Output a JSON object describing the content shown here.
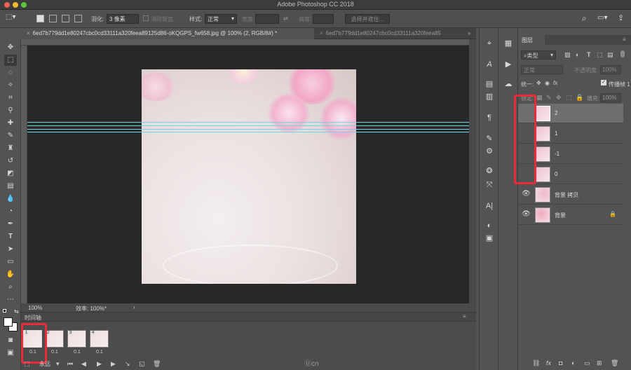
{
  "app": {
    "title": "Adobe Photoshop CC 2018"
  },
  "options_bar": {
    "feather_label": "羽化:",
    "feather_value": "3 像素",
    "antialias_label": "消除锯齿",
    "style_label": "样式:",
    "style_value": "正常",
    "width_label": "宽度:",
    "height_label": "高度:",
    "select_mask_button": "选择并遮住..."
  },
  "tabs": [
    {
      "label": "6ed7b779dd1e80247cbc0cd33111a320feea89125d86-oKQGPS_fw658.jpg @ 100% (2, RGB/8#) *"
    },
    {
      "label": "6ed7b779dd1e80247cbc0cd33111a320feea85"
    }
  ],
  "status": {
    "zoom": "100%",
    "efficiency": "效率: 100%*"
  },
  "timeline": {
    "title": "时间轴",
    "loop_label": "永远",
    "frames": [
      {
        "number": "1",
        "delay": "0.1"
      },
      {
        "number": "2",
        "delay": "0.1"
      },
      {
        "number": "3",
        "delay": "0.1"
      },
      {
        "number": "4",
        "delay": "0.1"
      }
    ]
  },
  "layers_panel": {
    "tab": "图层",
    "filter_kind": "类型",
    "blend_mode": "正常",
    "opacity_label": "不透明度:",
    "opacity_value": "100%",
    "unify_label": "统一:",
    "propagate_label": "传播帧 1",
    "lock_label": "锁定:",
    "fill_label": "填充:",
    "fill_value": "100%",
    "layers": [
      {
        "name": "2",
        "visible": false,
        "selected": true
      },
      {
        "name": "1",
        "visible": false,
        "selected": false
      },
      {
        "name": "-1",
        "visible": false,
        "selected": false
      },
      {
        "name": "0",
        "visible": false,
        "selected": false
      },
      {
        "name": "背景 拷贝",
        "visible": true,
        "selected": false
      },
      {
        "name": "背景",
        "visible": true,
        "selected": false,
        "locked": true
      }
    ]
  },
  "watermark": "cn",
  "colors": {
    "guide": "#6fd6e6",
    "highlight": "#ec2b3a",
    "canvas_bg": "#282828",
    "panel_bg": "#535353"
  }
}
